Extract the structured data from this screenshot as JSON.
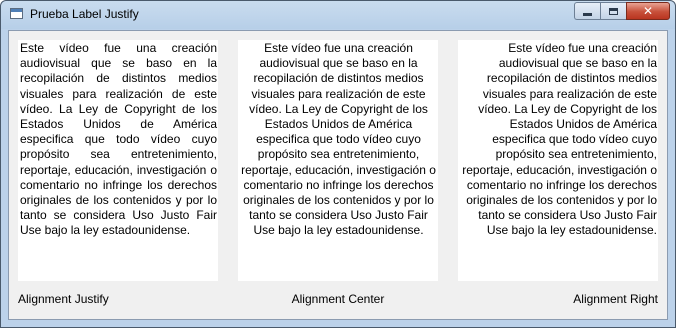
{
  "window": {
    "title": "Prueba Label Justify",
    "controls": {
      "minimize": "minimize-icon",
      "maximize": "maximize-icon",
      "close": "close-icon"
    }
  },
  "labels": {
    "text": "Este vídeo fue una creación audiovisual que se baso en la recopilación de distintos medios visuales para realización de este vídeo. La Ley de Copyright de los Estados Unidos de América especifica que todo vídeo cuyo propósito sea entretenimiento, reportaje, educación, investigación o comentario no infringe los derechos originales de los contenidos y por lo tanto se considera Uso Justo Fair Use bajo la ley estadounidense.",
    "captions": {
      "justify": "Alignment Justify",
      "center": "Alignment Center",
      "right": "Alignment Right"
    }
  },
  "colors": {
    "window_frame": "#bcd2ea",
    "client_bg": "#f0f0f0",
    "label_bg": "#ffffff",
    "close_button": "#c7503a"
  }
}
